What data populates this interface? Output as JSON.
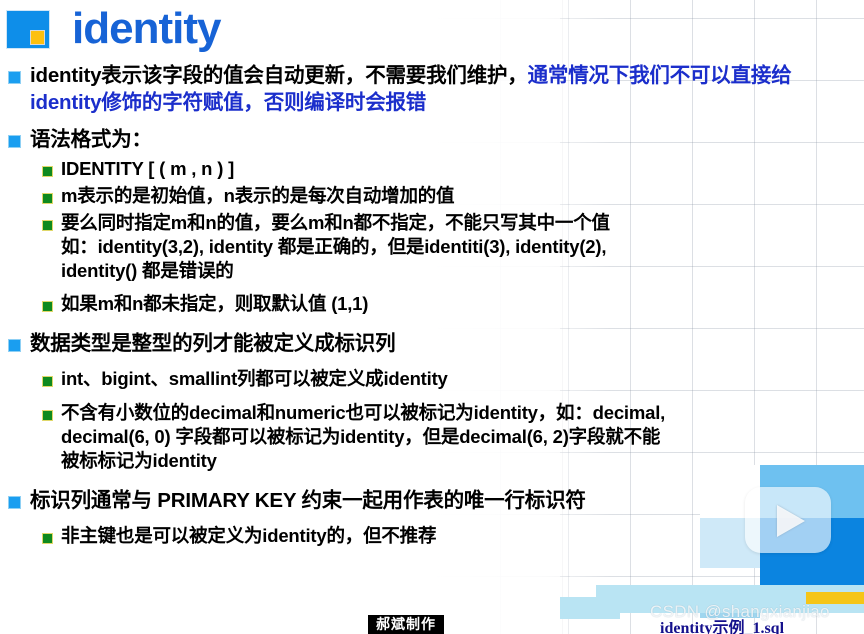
{
  "slide": {
    "title": "identity",
    "logo_colors": {
      "block": "#0e8ee9",
      "accent_square": "#fdc010"
    },
    "title_color": "#1763d6",
    "bullet_l1_color": "#1a9ef0",
    "bullet_l2_color": "#0f8a1e",
    "highlight_text_color": "#1b2ecb"
  },
  "bullets": {
    "b1_black": "identity表示该字段的值会自动更新，不需要我们维护，",
    "b1_blue": "通常情况下我们不可以直接给identity修饰的字符赋值，否则编译时会报错",
    "b2": "语法格式为：",
    "b2_1": "IDENTITY [ ( m , n ) ]",
    "b2_2": "m表示的是初始值，n表示的是每次自动增加的值",
    "b2_3_line1": "要么同时指定m和n的值，要么m和n都不指定，不能只写其中一个值",
    "b2_3_line2": "如：identity(3,2),   identity 都是正确的，但是identiti(3), identity(2),",
    "b2_3_line3": "identity() 都是错误的",
    "b2_4": "如果m和n都未指定，则取默认值 (1,1)",
    "b3": "数据类型是整型的列才能被定义成标识列",
    "b3_1": "int、bigint、smallint列都可以被定义成identity",
    "b3_2_line1": "不含有小数位的decimal和numeric也可以被标记为identity，如：decimal,",
    "b3_2_line2": "decimal(6, 0) 字段都可以被标记为identity，但是decimal(6, 2)字段就不能",
    "b3_2_line3": "被标标记为identity",
    "b4": "标识列通常与 PRIMARY KEY 约束一起用作表的唯一行标识符",
    "b4_1": "非主键也是可以被定义为identity的，但不推荐"
  },
  "footer": {
    "maker_label": "郝斌制作",
    "filename": "identity示例_1.sql",
    "watermark": "CSDN @shangxianjiao"
  },
  "player": {
    "play_icon": "play-triangle-icon"
  }
}
